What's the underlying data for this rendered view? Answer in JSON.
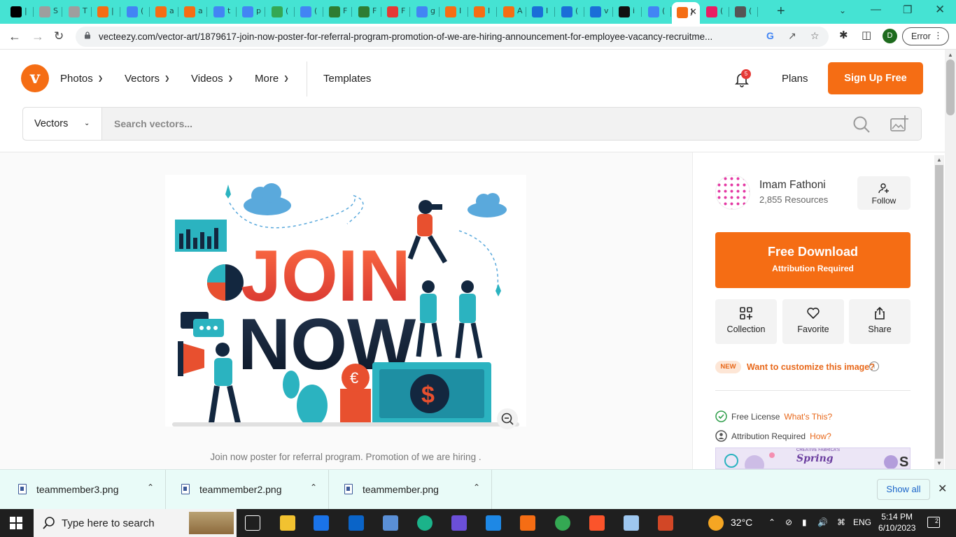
{
  "browser": {
    "tabs": [
      {
        "label": "|",
        "color": "#000000"
      },
      {
        "label": "S",
        "color": "#9e9e9e"
      },
      {
        "label": "T",
        "color": "#9e9e9e"
      },
      {
        "label": "|",
        "color": "#f56d14"
      },
      {
        "label": "(",
        "color": "#4285f4"
      },
      {
        "label": "a",
        "color": "#f56d14"
      },
      {
        "label": "a",
        "color": "#f56d14"
      },
      {
        "label": "t",
        "color": "#4285f4"
      },
      {
        "label": "p",
        "color": "#4285f4"
      },
      {
        "label": "(",
        "color": "#34a853"
      },
      {
        "label": "(",
        "color": "#4285f4"
      },
      {
        "label": "F",
        "color": "#2e7d32"
      },
      {
        "label": "F",
        "color": "#2e7d32"
      },
      {
        "label": "F",
        "color": "#e53935"
      },
      {
        "label": "g",
        "color": "#4285f4"
      },
      {
        "label": "I",
        "color": "#f56d14"
      },
      {
        "label": "I",
        "color": "#f56d14"
      },
      {
        "label": "A",
        "color": "#f56d14"
      },
      {
        "label": "I",
        "color": "#1a6ed8"
      },
      {
        "label": "(",
        "color": "#1a6ed8"
      },
      {
        "label": "v",
        "color": "#1a6ed8"
      },
      {
        "label": "i",
        "color": "#111111"
      },
      {
        "label": "(",
        "color": "#4285f4"
      },
      {
        "label": "J",
        "color": "#f56d14"
      },
      {
        "label": "(",
        "color": "#e91e63"
      },
      {
        "label": "(",
        "color": "#555555"
      }
    ],
    "active_tab_index": 23,
    "url": "vecteezy.com/vector-art/1879617-join-now-poster-for-referral-program-promotion-of-we-are-hiring-announcement-for-employee-vacancy-recruitme...",
    "profile_initial": "D",
    "error_label": "Error"
  },
  "header": {
    "nav": [
      {
        "label": "Photos",
        "dropdown": true
      },
      {
        "label": "Vectors",
        "dropdown": true
      },
      {
        "label": "Videos",
        "dropdown": true
      },
      {
        "label": "More",
        "dropdown": true
      },
      {
        "label": "Templates",
        "dropdown": false
      }
    ],
    "notification_count": "5",
    "plans_label": "Plans",
    "signup_label": "Sign Up Free",
    "brand_color": "#f56d14"
  },
  "search": {
    "category": "Vectors",
    "placeholder": "Search vectors..."
  },
  "asset": {
    "caption_line1": "Join now poster for referral program. Promotion of we are hiring .",
    "poster_words": [
      "JOIN",
      "NOW"
    ]
  },
  "sidebar": {
    "author_name": "Imam Fathoni",
    "author_resources": "2,855 Resources",
    "follow_label": "Follow",
    "download_title": "Free Download",
    "download_subtitle": "Attribution Required",
    "actions": [
      {
        "label": "Collection",
        "icon": "collection-icon"
      },
      {
        "label": "Favorite",
        "icon": "heart-icon"
      },
      {
        "label": "Share",
        "icon": "share-icon"
      }
    ],
    "new_badge": "NEW",
    "customize_label": "Want to customize this image?",
    "license": {
      "label": "Free License",
      "link": "What's This?"
    },
    "attribution": {
      "label": "Attribution Required",
      "link": "How?"
    },
    "ad": {
      "small": "CREATIVE FABRICA'S",
      "title": "Spring"
    }
  },
  "downloads": {
    "items": [
      "teammember3.png",
      "teammember2.png",
      "teammember.png"
    ],
    "show_all": "Show all"
  },
  "taskbar": {
    "search_placeholder": "Type here to search",
    "weather": "32°C",
    "language": "ENG",
    "time": "5:14 PM",
    "date": "6/10/2023",
    "notification_count": "2"
  }
}
